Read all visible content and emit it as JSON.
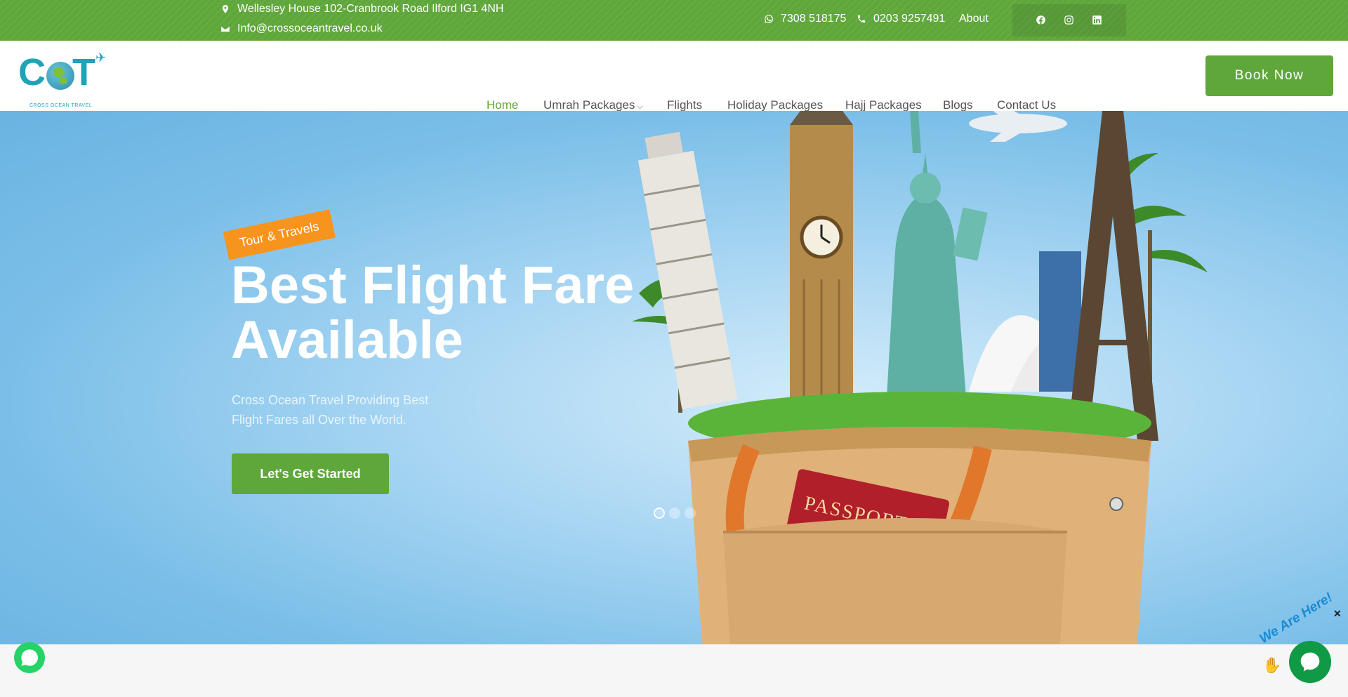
{
  "topbar": {
    "address": "Wellesley House 102-Cranbrook Road Ilford IG1 4NH",
    "email": "Info@crossoceantravel.co.uk",
    "whatsapp_phone": "7308 518175",
    "phone": "0203 9257491",
    "about_label": "About",
    "social": [
      "facebook-icon",
      "instagram-icon",
      "linkedin-icon"
    ]
  },
  "logo": {
    "text": "COT",
    "subtitle": "CROSS OCEAN TRAVEL"
  },
  "nav": {
    "items": [
      {
        "label": "Home",
        "active": true
      },
      {
        "label": "Umrah Packages",
        "dropdown": true
      },
      {
        "label": "Flights"
      },
      {
        "label": "Holiday Packages"
      },
      {
        "label": "Hajj Packages"
      },
      {
        "label": "Blogs"
      },
      {
        "label": "Contact Us"
      }
    ],
    "book_label": "Book Now"
  },
  "hero": {
    "tag": "Tour & Travels",
    "title_line1": "Best Flight Fare",
    "title_line2": "Available",
    "subtitle_line1": "Cross Ocean Travel Providing Best",
    "subtitle_line2": "Flight Fares all Over the World.",
    "cta": "Let's Get Started",
    "passport_text": "PASSPORT",
    "slides": 3,
    "active_slide": 1
  },
  "widgets": {
    "chat_text": "We Are Here!"
  },
  "colors": {
    "brand_green": "#5fa73b",
    "accent_orange": "#f7941d",
    "logo_teal": "#1fa3b6"
  }
}
